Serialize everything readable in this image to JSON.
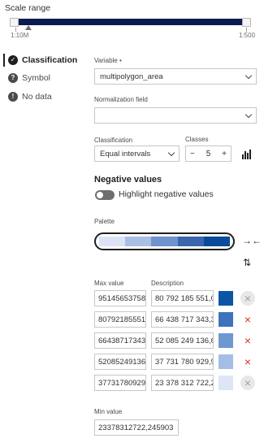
{
  "scale_range": {
    "title": "Scale range",
    "min_label": "1:10M",
    "max_label": "1:500"
  },
  "nav": {
    "items": [
      {
        "label": "Classification",
        "icon": "check-circle-icon",
        "active": true
      },
      {
        "label": "Symbol",
        "icon": "question-circle-icon",
        "active": false
      },
      {
        "label": "No data",
        "icon": "exclamation-circle-icon",
        "active": false
      }
    ]
  },
  "variable": {
    "label": "Variable •",
    "value": "multipolygon_area"
  },
  "normalization": {
    "label": "Normalization field",
    "value": ""
  },
  "classification": {
    "label": "Classification",
    "value": "Equal intervals"
  },
  "classes": {
    "label": "Classes",
    "value": "5",
    "minus": "−",
    "plus": "+"
  },
  "negative": {
    "heading": "Negative values",
    "toggle_label": "Highlight negative values",
    "toggle_on": false
  },
  "palette": {
    "label": "Palette",
    "colors": [
      "#dbe3f5",
      "#a9bfe3",
      "#6f93cc",
      "#3a66ad",
      "#0a4a9a"
    ]
  },
  "table": {
    "max_header": "Max value",
    "desc_header": "Description",
    "rows": [
      {
        "max": "95145653758",
        "desc": "80 792 185 551,0",
        "color": "#0c55a6",
        "removable": false
      },
      {
        "max": "80792185551",
        "desc": "66 438 717 343,3",
        "color": "#3d72bd",
        "removable": true
      },
      {
        "max": "66438717343",
        "desc": "52 085 249 136,6",
        "color": "#6e98d1",
        "removable": true
      },
      {
        "max": "52085249136",
        "desc": "37 731 780 929,9",
        "color": "#a3bde6",
        "removable": true
      },
      {
        "max": "37731780929",
        "desc": "23 378 312 722,2",
        "color": "#dde5f7",
        "removable": false
      }
    ],
    "remove_glyph": "×"
  },
  "min_value": {
    "label": "Min value",
    "value": "23378312722,245903"
  }
}
